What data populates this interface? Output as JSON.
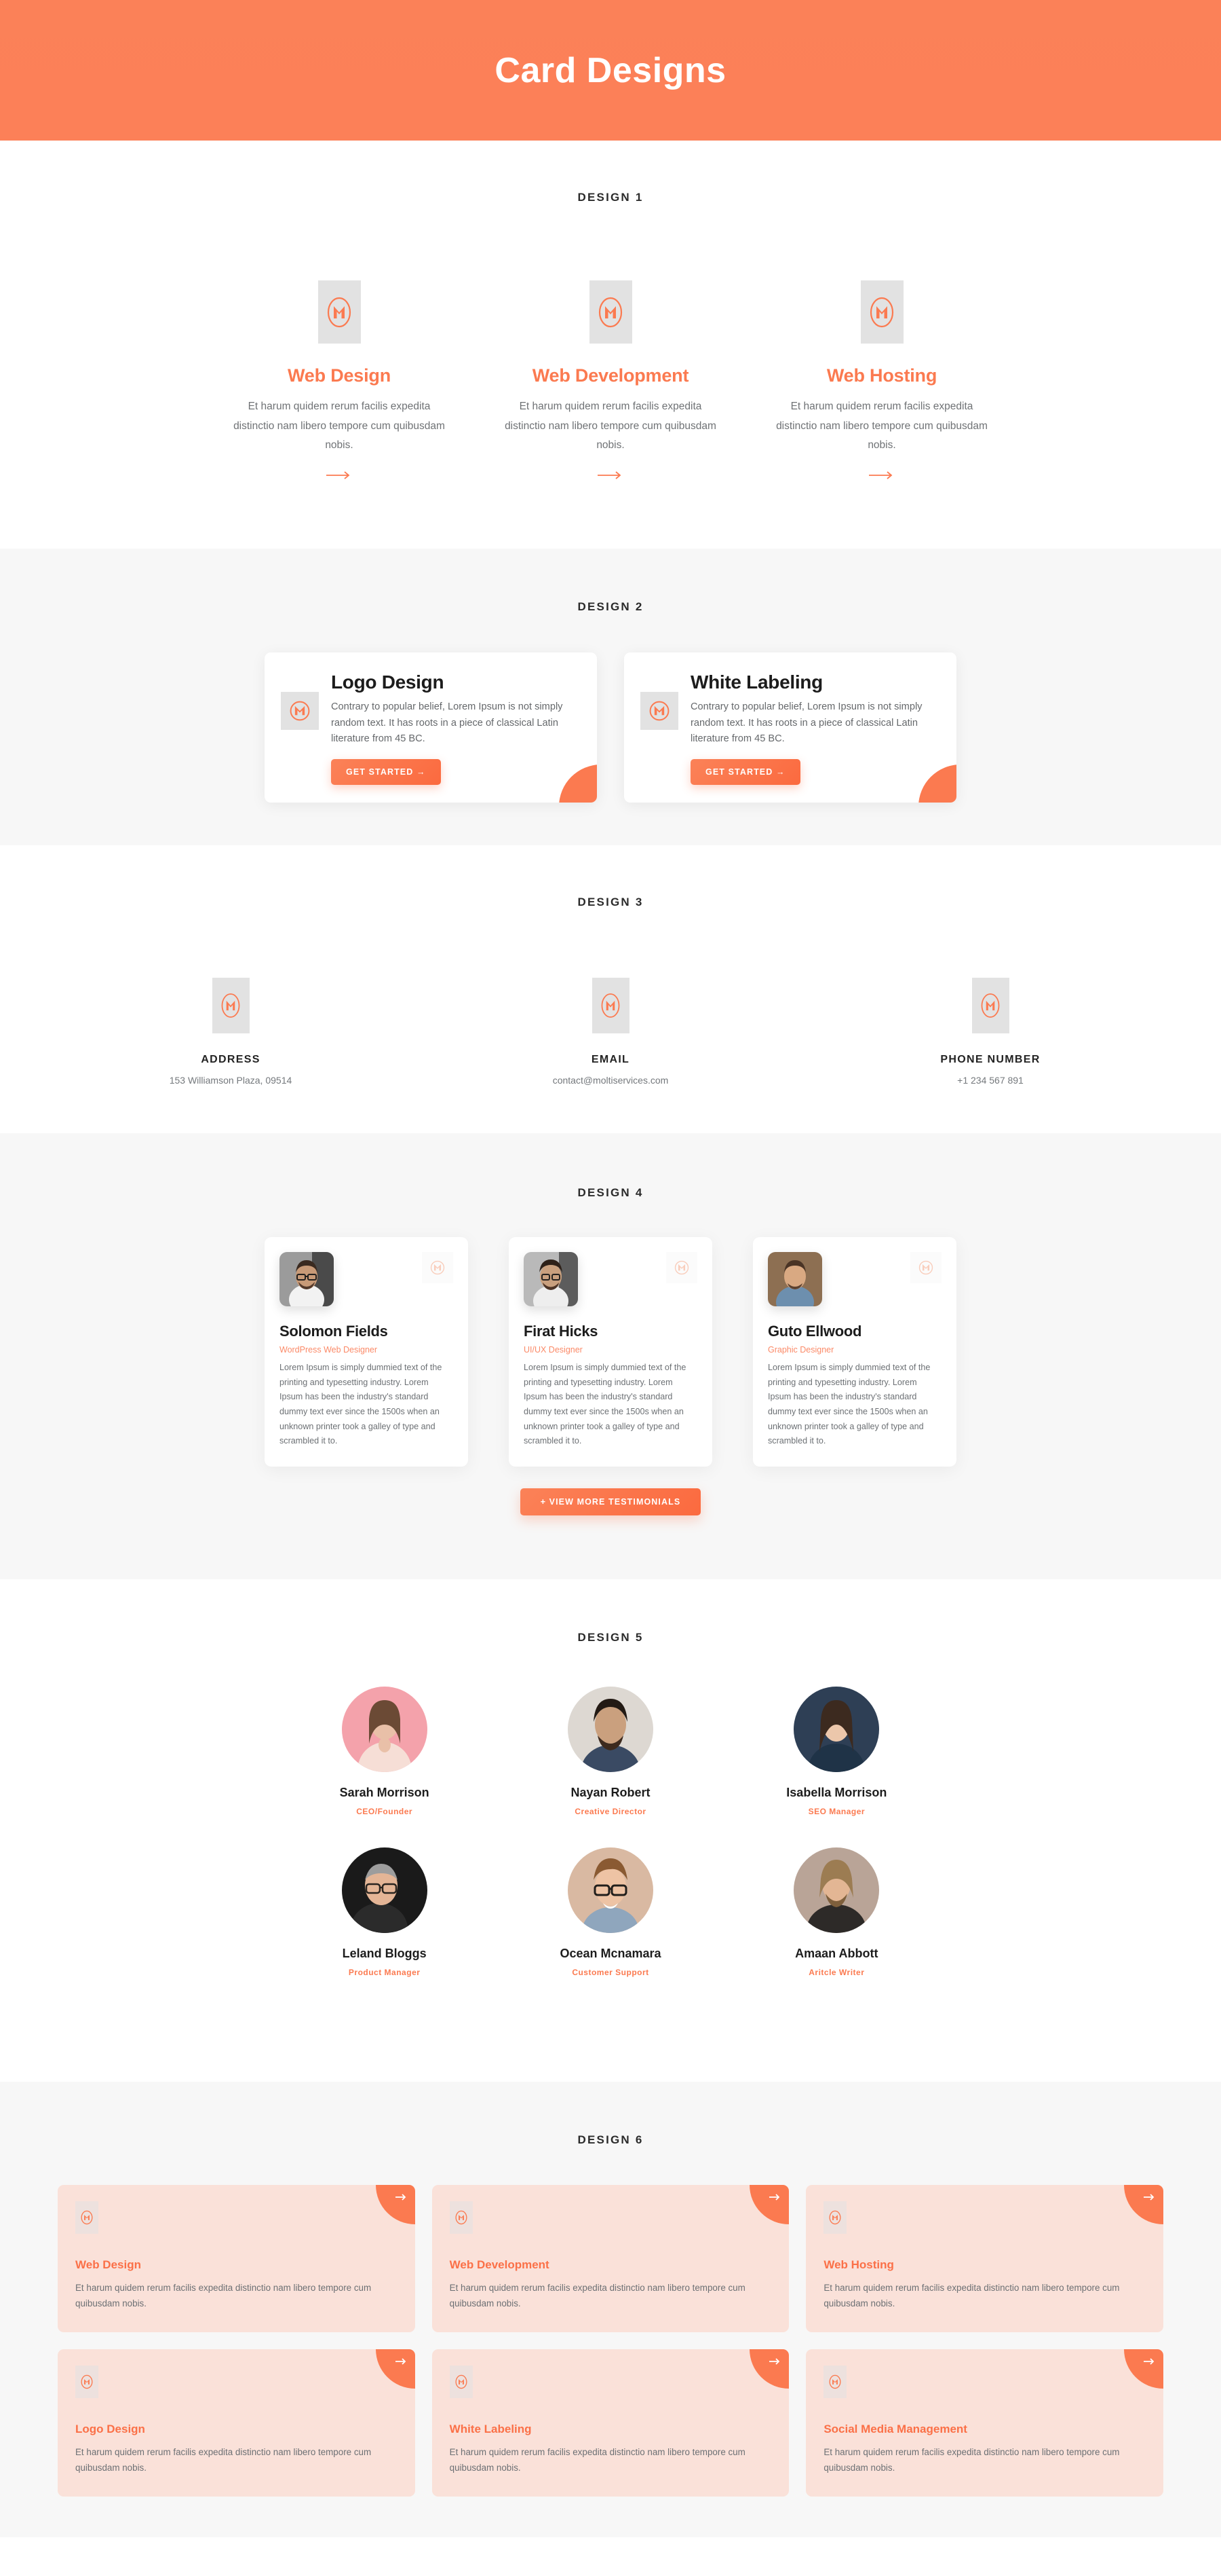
{
  "hero": {
    "title": "Card Designs",
    "bg_color": "#fb8158"
  },
  "theme": {
    "accent": "#fb7a50",
    "accent_dark": "#fb6a3f",
    "text_dark": "#1c1c1c",
    "text_muted": "#6c7074",
    "grey_section": "#f7f7f7",
    "card_pink": "#fae1d9",
    "icon_box_grey": "#e2e2e2"
  },
  "design1": {
    "label": "DESIGN 1",
    "cards": [
      {
        "icon": "m-logo-icon",
        "title": "Web Design",
        "desc": "Et harum quidem rerum facilis expedita distinctio nam libero tempore cum quibusdam nobis.",
        "arrow": "arrow-right-icon"
      },
      {
        "icon": "m-logo-icon",
        "title": "Web Development",
        "desc": "Et harum quidem rerum facilis expedita distinctio nam libero tempore cum quibusdam nobis.",
        "arrow": "arrow-right-icon"
      },
      {
        "icon": "m-logo-icon",
        "title": "Web Hosting",
        "desc": "Et harum quidem rerum facilis expedita distinctio nam libero tempore cum quibusdam nobis.",
        "arrow": "arrow-right-icon"
      }
    ]
  },
  "design2": {
    "label": "DESIGN 2",
    "cards": [
      {
        "icon": "m-logo-icon",
        "title": "Logo Design",
        "desc": "Contrary to popular belief, Lorem Ipsum is not simply random text. It has roots in a piece of classical Latin literature from 45 BC.",
        "button": "GET STARTED  →"
      },
      {
        "icon": "m-logo-icon",
        "title": "White Labeling",
        "desc": "Contrary to popular belief, Lorem Ipsum is not simply random text. It has roots in a piece of classical Latin literature from 45 BC.",
        "button": "GET STARTED  →"
      }
    ]
  },
  "design3": {
    "label": "DESIGN 3",
    "cards": [
      {
        "icon": "m-logo-icon",
        "title": "ADDRESS",
        "value": "153 Williamson Plaza, 09514"
      },
      {
        "icon": "m-logo-icon",
        "title": "EMAIL",
        "value": "contact@moltiservices.com"
      },
      {
        "icon": "m-logo-icon",
        "title": "PHONE NUMBER",
        "value": "+1 234 567 891"
      }
    ]
  },
  "design4": {
    "label": "DESIGN 4",
    "button": "+ VIEW MORE TESTIMONIALS",
    "cards": [
      {
        "avatar": "avatar-solomon",
        "name": "Solomon Fields",
        "role": "WordPress Web Designer",
        "text": "Lorem Ipsum is simply dummied text of the printing and typesetting industry. Lorem Ipsum has been the industry's standard dummy text ever since the 1500s when an unknown printer took a galley of type and scrambled it to.",
        "badge": "m-logo-icon"
      },
      {
        "avatar": "avatar-firat",
        "name": "Firat Hicks",
        "role": "UI/UX Designer",
        "text": "Lorem Ipsum is simply dummied text of the printing and typesetting industry. Lorem Ipsum has been the industry's standard dummy text ever since the 1500s when an unknown printer took a galley of type and scrambled it to.",
        "badge": "m-logo-icon"
      },
      {
        "avatar": "avatar-guto",
        "name": "Guto Ellwood",
        "role": "Graphic Designer",
        "text": "Lorem Ipsum is simply dummied text of the printing and typesetting industry. Lorem Ipsum has been the industry's standard dummy text ever since the 1500s when an unknown printer took a galley of type and scrambled it to.",
        "badge": "m-logo-icon"
      }
    ]
  },
  "design5": {
    "label": "DESIGN 5",
    "members": [
      {
        "avatar": "avatar-sarah",
        "name": "Sarah Morrison",
        "role": "CEO/Founder"
      },
      {
        "avatar": "avatar-nayan",
        "name": "Nayan Robert",
        "role": "Creative Director"
      },
      {
        "avatar": "avatar-isabella",
        "name": "Isabella Morrison",
        "role": "SEO Manager"
      },
      {
        "avatar": "avatar-leland",
        "name": "Leland Bloggs",
        "role": "Product Manager"
      },
      {
        "avatar": "avatar-ocean",
        "name": "Ocean Mcnamara",
        "role": "Customer Support"
      },
      {
        "avatar": "avatar-amaan",
        "name": "Amaan Abbott",
        "role": "Aritcle Writer"
      }
    ]
  },
  "design6": {
    "label": "DESIGN 6",
    "cards": [
      {
        "icon": "m-logo-icon",
        "title": "Web Design",
        "desc": "Et harum quidem rerum facilis expedita distinctio nam libero tempore cum quibusdam nobis.",
        "corner": "arrow-right-icon"
      },
      {
        "icon": "m-logo-icon",
        "title": "Web Development",
        "desc": "Et harum quidem rerum facilis expedita distinctio nam libero tempore cum quibusdam nobis.",
        "corner": "arrow-right-icon"
      },
      {
        "icon": "m-logo-icon",
        "title": "Web Hosting",
        "desc": "Et harum quidem rerum facilis expedita distinctio nam libero tempore cum quibusdam nobis.",
        "corner": "arrow-right-icon"
      },
      {
        "icon": "m-logo-icon",
        "title": "Logo Design",
        "desc": "Et harum quidem rerum facilis expedita distinctio nam libero tempore cum quibusdam nobis.",
        "corner": "arrow-right-icon"
      },
      {
        "icon": "m-logo-icon",
        "title": "White Labeling",
        "desc": "Et harum quidem rerum facilis expedita distinctio nam libero tempore cum quibusdam nobis.",
        "corner": "arrow-right-icon"
      },
      {
        "icon": "m-logo-icon",
        "title": "Social Media Management",
        "desc": "Et harum quidem rerum facilis expedita distinctio nam libero tempore cum quibusdam nobis.",
        "corner": "arrow-right-icon"
      }
    ]
  }
}
